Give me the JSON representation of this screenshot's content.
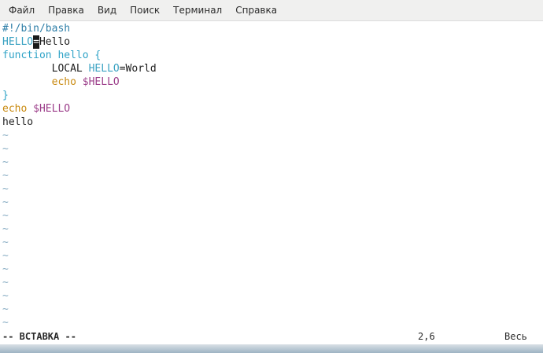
{
  "menu": {
    "items": [
      "Файл",
      "Правка",
      "Вид",
      "Поиск",
      "Терминал",
      "Справка"
    ]
  },
  "editor": {
    "l1": "#!/bin/bash",
    "l2_var": "HELLO",
    "l2_cursor": "=",
    "l2_rest": "Hello",
    "l3_kw": "function hello {",
    "l4_indent": "        ",
    "l4_local": "LOCAL ",
    "l4_var": "HELLO",
    "l4_rest": "=World",
    "l5_indent": "        ",
    "l5_echo": "echo ",
    "l5_dollar": "$HELLO",
    "l6_brace": "}",
    "l7_echo": "echo ",
    "l7_dollar": "$HELLO",
    "l8": "hello",
    "tilde": "~"
  },
  "status": {
    "mode": "-- ВСТАВКА --",
    "position": "2,6",
    "scroll": "Весь"
  },
  "colors": {
    "background": "#ffffff",
    "menubar": "#f0f0ef",
    "keyword": "#2fa3c7",
    "echo": "#c98a10",
    "variable_ref": "#9c3e8a"
  }
}
